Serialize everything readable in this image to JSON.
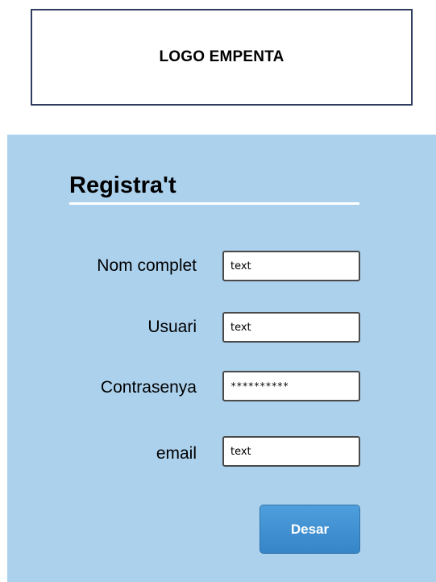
{
  "header": {
    "logo_text": "LOGO EMPENTA"
  },
  "form": {
    "title": "Registra't",
    "fields": [
      {
        "label": "Nom complet",
        "value": "text"
      },
      {
        "label": "Usuari",
        "value": "text"
      },
      {
        "label": "Contrasenya",
        "value": "**********"
      },
      {
        "label": "email",
        "value": "text"
      }
    ],
    "submit_label": "Desar"
  },
  "colors": {
    "panel_background": "#acd1ed",
    "logo_border": "#2f3e5e",
    "button_background": "#3f91d3",
    "button_text": "#ffffff"
  }
}
